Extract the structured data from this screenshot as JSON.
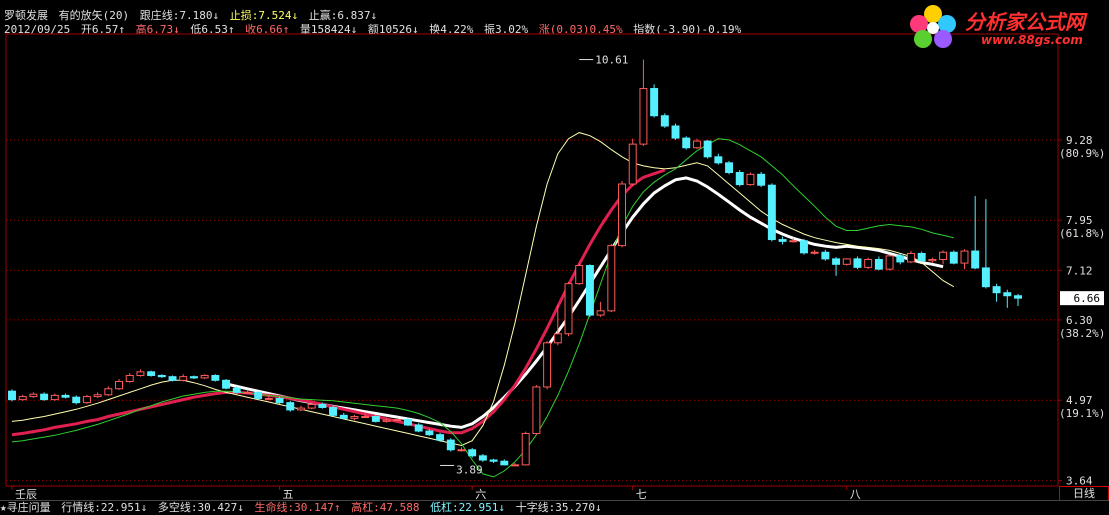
{
  "header": {
    "stock_name": "罗顿发展",
    "indicator": "有的放矢(20)",
    "track_line": "跟庄线:7.180↓",
    "stop_loss": "止损:7.524↓",
    "take_profit": "止赢:6.837↓",
    "date": "2012/09/25",
    "open": "开6.57↑",
    "high": "高6.73↓",
    "low": "低6.53↑",
    "close": "收6.66↑",
    "volume": "量158424↓",
    "amount": "额10526↓",
    "turnover": "换4.22%",
    "amplitude": "振3.02%",
    "change": "涨(0.03)0.45%",
    "index": "指数(-3.90)-0.19%"
  },
  "logo": {
    "title": "分析家公式网",
    "url": "www.88gs.com"
  },
  "footer": {
    "query": "★寻庄问量",
    "trend": "行情线:22.951↓",
    "longshort": "多空线:30.427↓",
    "life": "生命线:30.147↑",
    "high_lever": "高杠:47.588",
    "low_lever": "低杠:22.951↓",
    "cross": "十字线:35.270↓"
  },
  "period_button": "日线",
  "colors": {
    "up": "#ff5a5a",
    "down": "#54f0ff",
    "white_line": "#ffffff",
    "green_line": "#2fd02f",
    "red_line": "#e02050",
    "yellow_line": "#ffffb0",
    "grid": "#a00000"
  },
  "chart_data": {
    "type": "candlestick",
    "y_ticks": [
      "3.64",
      "4.97",
      "6.30",
      "7.12",
      "7.95",
      "9.28"
    ],
    "y_tick_values": [
      3.64,
      4.97,
      6.3,
      7.12,
      7.95,
      9.28
    ],
    "pct_labels": [
      "(19.1%)",
      "(38.2%)",
      "(61.8%)",
      "(80.9%)"
    ],
    "pct_values": [
      4.97,
      6.3,
      7.95,
      9.28
    ],
    "x_labels": [
      "壬辰",
      "五",
      "六",
      "七",
      "八"
    ],
    "x_label_index": [
      0,
      25,
      43,
      58,
      78
    ],
    "ylim": [
      3.55,
      11.0
    ],
    "annotations": {
      "max_label": "10.61",
      "max_value": 10.61,
      "max_index": 53,
      "min_label": "3.89",
      "min_value": 3.89,
      "min_index": 40,
      "last_price": "6.66"
    },
    "open": [
      5.12,
      4.98,
      5.03,
      5.07,
      4.98,
      5.05,
      5.02,
      4.93,
      5.03,
      5.06,
      5.16,
      5.28,
      5.38,
      5.44,
      5.38,
      5.36,
      5.3,
      5.36,
      5.34,
      5.38,
      5.3,
      5.17,
      5.1,
      5.1,
      5.0,
      5.0,
      4.93,
      4.81,
      4.84,
      4.9,
      4.85,
      4.72,
      4.67,
      4.7,
      4.7,
      4.62,
      4.64,
      4.65,
      4.56,
      4.46,
      4.4,
      4.31,
      4.15,
      4.15,
      4.05,
      3.98,
      3.96,
      3.9,
      3.9,
      4.42,
      5.19,
      5.92,
      6.07,
      6.9,
      7.2,
      6.38,
      6.45,
      7.53,
      8.55,
      9.21,
      10.13,
      9.68,
      9.51,
      9.31,
      9.15,
      9.26,
      9.0,
      8.9,
      8.74,
      8.54,
      8.71,
      8.53,
      7.63,
      7.6,
      7.61,
      7.41,
      7.42,
      7.31,
      7.22,
      7.31,
      7.17,
      7.3,
      7.14,
      7.36,
      7.26,
      7.4,
      7.28,
      7.3,
      7.42,
      7.24,
      7.44,
      7.16,
      6.85,
      6.75,
      6.7
    ],
    "close": [
      4.98,
      5.03,
      5.07,
      4.98,
      5.05,
      5.02,
      4.93,
      5.03,
      5.06,
      5.16,
      5.28,
      5.38,
      5.44,
      5.38,
      5.36,
      5.3,
      5.36,
      5.34,
      5.38,
      5.3,
      5.17,
      5.1,
      5.1,
      5.0,
      5.0,
      4.93,
      4.81,
      4.84,
      4.9,
      4.85,
      4.72,
      4.67,
      4.7,
      4.7,
      4.62,
      4.64,
      4.65,
      4.56,
      4.46,
      4.4,
      4.31,
      4.15,
      4.15,
      4.05,
      3.98,
      3.96,
      3.9,
      3.9,
      4.42,
      5.19,
      5.92,
      6.07,
      6.9,
      7.2,
      6.38,
      6.45,
      7.53,
      8.55,
      9.21,
      10.13,
      9.68,
      9.51,
      9.31,
      9.15,
      9.26,
      9.0,
      8.9,
      8.74,
      8.54,
      8.71,
      8.53,
      7.63,
      7.6,
      7.61,
      7.41,
      7.42,
      7.31,
      7.22,
      7.31,
      7.17,
      7.3,
      7.14,
      7.36,
      7.26,
      7.4,
      7.28,
      7.3,
      7.42,
      7.24,
      7.44,
      7.16,
      6.85,
      6.75,
      6.7,
      6.66
    ],
    "high": [
      5.15,
      5.06,
      5.1,
      5.1,
      5.08,
      5.08,
      5.05,
      5.06,
      5.1,
      5.2,
      5.32,
      5.42,
      5.48,
      5.46,
      5.4,
      5.38,
      5.4,
      5.38,
      5.4,
      5.4,
      5.32,
      5.2,
      5.14,
      5.12,
      5.05,
      5.03,
      4.96,
      4.88,
      4.93,
      4.93,
      4.88,
      4.76,
      4.73,
      4.75,
      4.73,
      4.68,
      4.68,
      4.68,
      4.59,
      4.49,
      4.43,
      4.34,
      4.19,
      4.18,
      4.08,
      4.0,
      3.99,
      3.93,
      4.45,
      5.22,
      5.95,
      6.55,
      6.93,
      7.23,
      7.22,
      6.6,
      7.56,
      8.6,
      9.3,
      10.61,
      10.2,
      9.72,
      9.55,
      9.34,
      9.3,
      9.28,
      9.05,
      8.93,
      8.78,
      8.74,
      8.75,
      8.56,
      7.68,
      7.65,
      7.64,
      7.46,
      7.46,
      7.34,
      7.32,
      7.35,
      7.33,
      7.35,
      7.38,
      7.4,
      7.44,
      7.43,
      7.33,
      7.45,
      7.45,
      7.47,
      8.35,
      8.3,
      6.9,
      6.8,
      6.73
    ],
    "low": [
      4.95,
      4.96,
      5.01,
      4.96,
      4.96,
      5.0,
      4.9,
      4.91,
      5.01,
      5.04,
      5.14,
      5.26,
      5.36,
      5.36,
      5.34,
      5.28,
      5.28,
      5.32,
      5.32,
      5.28,
      5.15,
      5.08,
      5.07,
      4.98,
      4.97,
      4.9,
      4.78,
      4.79,
      4.82,
      4.83,
      4.7,
      4.65,
      4.64,
      4.68,
      4.6,
      4.6,
      4.62,
      4.54,
      4.44,
      4.38,
      4.28,
      4.12,
      4.12,
      4.02,
      3.95,
      3.93,
      3.89,
      3.88,
      3.89,
      4.4,
      5.15,
      5.88,
      6.03,
      6.88,
      6.35,
      6.35,
      6.43,
      7.5,
      8.52,
      9.18,
      9.65,
      9.48,
      9.28,
      9.12,
      9.13,
      8.97,
      8.87,
      8.71,
      8.51,
      8.52,
      8.5,
      7.6,
      7.55,
      7.58,
      7.38,
      7.38,
      7.28,
      7.03,
      7.2,
      7.14,
      7.14,
      7.12,
      7.12,
      7.22,
      7.24,
      7.25,
      7.25,
      7.22,
      7.22,
      7.14,
      7.14,
      6.82,
      6.6,
      6.5,
      6.53
    ],
    "series": [
      {
        "key": "white",
        "values": [
          null,
          null,
          null,
          null,
          null,
          null,
          null,
          null,
          null,
          null,
          null,
          null,
          null,
          null,
          null,
          null,
          null,
          null,
          null,
          null,
          5.24,
          5.2,
          5.16,
          5.12,
          5.08,
          5.04,
          5.0,
          4.96,
          4.93,
          4.9,
          4.87,
          4.84,
          4.81,
          4.78,
          4.75,
          4.72,
          4.69,
          4.66,
          4.63,
          4.6,
          4.57,
          4.54,
          4.52,
          4.58,
          4.7,
          4.85,
          5.02,
          5.2,
          5.4,
          5.62,
          5.85,
          6.1,
          6.35,
          6.62,
          6.9,
          7.18,
          7.46,
          7.74,
          8.0,
          8.22,
          8.4,
          8.52,
          8.62,
          8.65,
          8.6,
          8.5,
          8.38,
          8.25,
          8.12,
          8.0,
          7.9,
          7.8,
          7.72,
          7.65,
          7.6,
          7.55,
          7.52,
          7.5,
          7.52,
          7.5,
          7.48,
          7.45,
          7.4,
          7.35,
          7.3,
          7.25,
          7.22,
          7.18
        ]
      },
      {
        "key": "red",
        "values": [
          4.4,
          4.42,
          4.45,
          4.48,
          4.52,
          4.55,
          4.58,
          4.62,
          4.65,
          4.7,
          4.74,
          4.78,
          4.82,
          4.86,
          4.9,
          4.94,
          4.98,
          5.02,
          5.05,
          5.08,
          5.1,
          5.1,
          5.09,
          5.07,
          5.05,
          5.03,
          5.0,
          4.97,
          4.94,
          4.9,
          4.86,
          4.82,
          4.78,
          4.74,
          4.7,
          4.66,
          4.62,
          4.58,
          4.54,
          4.5,
          4.46,
          4.43,
          4.43,
          4.5,
          4.62,
          4.78,
          4.98,
          5.22,
          5.5,
          5.82,
          6.16,
          6.52,
          6.88,
          7.22,
          7.55,
          7.85,
          8.12,
          8.36,
          8.54,
          8.66,
          8.72,
          8.78
        ]
      },
      {
        "key": "yellow",
        "values": [
          4.62,
          4.64,
          4.67,
          4.7,
          4.74,
          4.78,
          4.82,
          4.87,
          4.92,
          4.98,
          5.04,
          5.1,
          5.16,
          5.22,
          5.27,
          5.3,
          5.3,
          5.26,
          5.21,
          5.15,
          5.1,
          5.06,
          5.02,
          4.98,
          4.94,
          4.9,
          4.86,
          4.82,
          4.78,
          4.74,
          4.7,
          4.66,
          4.62,
          4.58,
          4.54,
          4.5,
          4.46,
          4.42,
          4.38,
          4.34,
          4.3,
          4.26,
          4.22,
          4.3,
          4.55,
          4.95,
          5.55,
          6.25,
          7.05,
          7.85,
          8.55,
          9.05,
          9.3,
          9.4,
          9.35,
          9.25,
          9.12,
          9.0,
          8.9,
          8.85,
          8.82,
          8.8,
          8.82,
          8.86,
          8.9,
          8.85,
          8.7,
          8.55,
          8.4,
          8.25,
          8.1,
          7.98,
          7.88,
          7.8,
          7.72,
          7.66,
          7.62,
          7.58,
          7.55,
          7.52,
          7.5,
          7.48,
          7.45,
          7.4,
          7.35,
          7.25,
          7.1,
          6.95,
          6.85
        ]
      },
      {
        "key": "green",
        "values": [
          4.28,
          4.3,
          4.33,
          4.36,
          4.39,
          4.43,
          4.47,
          4.52,
          4.57,
          4.63,
          4.69,
          4.75,
          4.82,
          4.88,
          4.94,
          4.99,
          5.04,
          5.07,
          5.1,
          5.12,
          5.12,
          5.11,
          5.09,
          5.07,
          5.05,
          5.03,
          5.01,
          4.99,
          4.98,
          4.97,
          4.96,
          4.94,
          4.92,
          4.9,
          4.88,
          4.86,
          4.84,
          4.8,
          4.75,
          4.68,
          4.6,
          4.45,
          4.25,
          3.98,
          3.75,
          3.7,
          3.8,
          3.95,
          4.15,
          4.4,
          4.7,
          5.05,
          5.45,
          5.9,
          6.4,
          6.9,
          7.4,
          7.85,
          8.18,
          8.42,
          8.58,
          8.7,
          8.8,
          8.95,
          9.1,
          9.2,
          9.3,
          9.28,
          9.2,
          9.1,
          9.0,
          8.85,
          8.7,
          8.52,
          8.35,
          8.18,
          8.0,
          7.85,
          7.78,
          7.78,
          7.82,
          7.86,
          7.88,
          7.86,
          7.84,
          7.8,
          7.74,
          7.7,
          7.66
        ]
      }
    ]
  }
}
